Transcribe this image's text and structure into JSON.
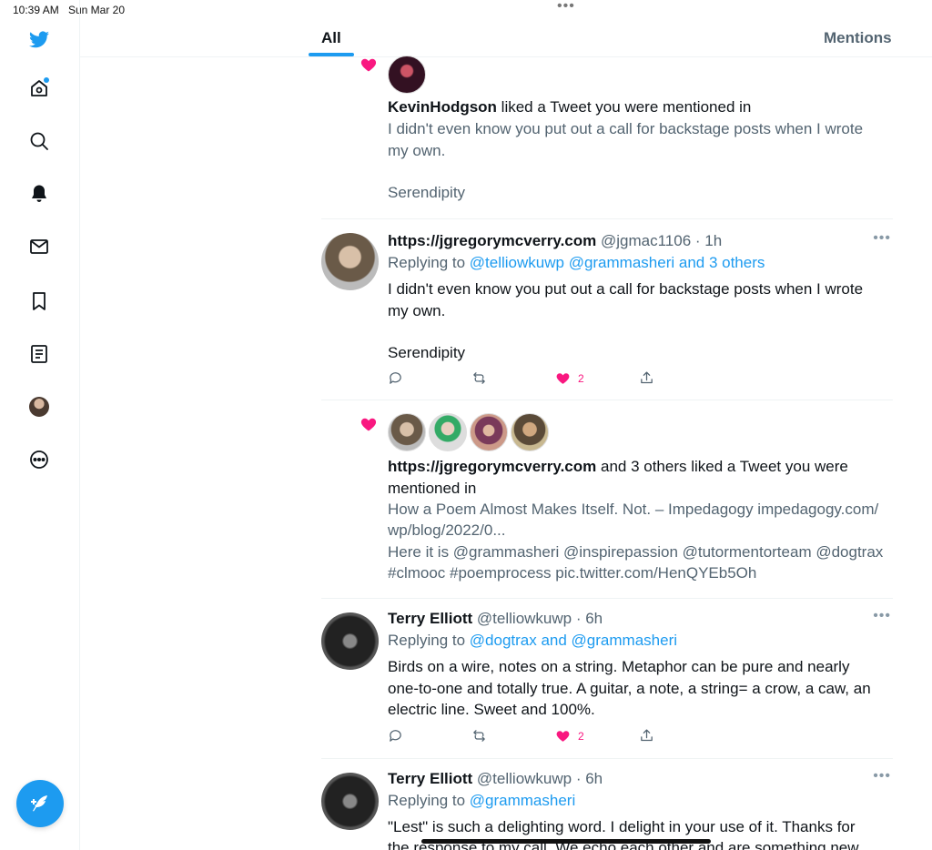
{
  "status": {
    "time": "10:39 AM",
    "date": "Sun Mar 20"
  },
  "sidebar": {
    "items": [
      {
        "icon": "twitter-logo-icon"
      },
      {
        "icon": "home-icon"
      },
      {
        "icon": "search-icon"
      },
      {
        "icon": "bell-icon"
      },
      {
        "icon": "mail-icon"
      },
      {
        "icon": "bookmark-icon"
      },
      {
        "icon": "lists-icon"
      },
      {
        "icon": "profile-avatar"
      },
      {
        "icon": "more-circle-icon"
      }
    ],
    "compose_icon": "compose-feather-icon"
  },
  "tabs": {
    "all": "All",
    "mentions": "Mentions"
  },
  "feed": {
    "n1": {
      "user": "KevinHodgson",
      "action": " liked a Tweet you were mentioned in",
      "line1": "I didn't even know you put out a call for backstage posts when I wrote",
      "line2": "my own.",
      "line3": "Serendipity"
    },
    "t1": {
      "name": "https://jgregorymcverry.com",
      "handle": " @jgmac1106 · 1h",
      "reply_prefix": "Replying to ",
      "reply_to": "@telliowkuwp @grammasheri and 3 others",
      "line1": "I didn't even know you put out a call for backstage posts when I wrote",
      "line2": "my own.",
      "line3": "Serendipity",
      "likes": "2"
    },
    "n2": {
      "user": "https://jgregorymcverry.com",
      "action": " and 3 others liked a Tweet you were",
      "action2": "mentioned in",
      "line1": "How a Poem Almost Makes Itself. Not. – Impedagogy impedagogy.com/",
      "line2": "wp/blog/2022/0...",
      "line3": "Here it is @grammasheri @inspirepassion  @tutormentorteam @dogtrax",
      "line4": "#clmooc #poemprocess pic.twitter.com/HenQYEb5Oh"
    },
    "t2": {
      "name": "Terry Elliott",
      "handle": " @telliowkuwp · 6h",
      "reply_prefix": "Replying to ",
      "reply_to": "@dogtrax and @grammasheri",
      "line1": "Birds on a wire, notes on a string.  Metaphor can be pure and nearly",
      "line2": "one-to-one and totally true. A guitar, a note, a string= a crow, a caw, an",
      "line3": "electric line.  Sweet and 100%.",
      "likes": "2"
    },
    "t3": {
      "name": "Terry Elliott",
      "handle": " @telliowkuwp · 6h",
      "reply_prefix": "Replying to ",
      "reply_to": "@grammasheri",
      "line1": "\"Lest\" is such a delighting word.  I delight in your use of it. Thanks for",
      "line2": "the response to my call. We echo each other and are something new."
    }
  },
  "colors": {
    "accent": "#1d9bf0",
    "like": "#f91880",
    "muted": "#536471"
  }
}
